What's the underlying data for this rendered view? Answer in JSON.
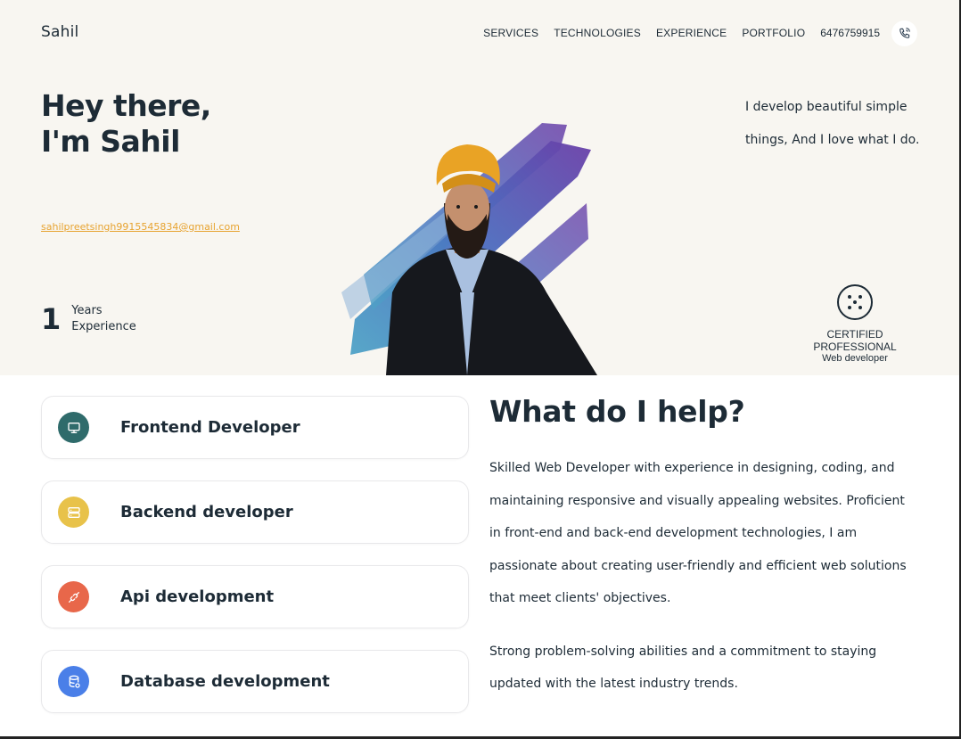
{
  "header": {
    "logo": "Sahil",
    "nav": [
      "SERVICES",
      "TECHNOLOGIES",
      "EXPERIENCE",
      "PORTFOLIO"
    ],
    "phone": "6476759915",
    "phone_icon": "phone-call-icon"
  },
  "hero": {
    "title_line1": "Hey there,",
    "title_line2": "I'm Sahil",
    "email": "sahilpreetsingh9915545834@gmail.com",
    "years_number": "1",
    "years_label_line1": "Years",
    "years_label_line2": "Experience",
    "tagline_line1": "I develop beautiful simple",
    "tagline_line2": "things, And I love what I do.",
    "cert_icon": "dice-icon",
    "cert_title": "CERTIFIED PROFESSIONAL",
    "cert_subtitle": "Web developer",
    "background_color": "#f8f6f1"
  },
  "services": [
    {
      "label": "Frontend Developer",
      "icon": "monitor-icon",
      "color": "#2f6b6b"
    },
    {
      "label": "Backend developer",
      "icon": "server-icon",
      "color": "#e8c24a"
    },
    {
      "label": "Api development",
      "icon": "plug-icon",
      "color": "#e8674a"
    },
    {
      "label": "Database development",
      "icon": "database-icon",
      "color": "#4a7fe8"
    }
  ],
  "help": {
    "title": "What do I help?",
    "para1_lines": [
      "Skilled Web Developer with experience in designing, coding, and",
      "maintaining responsive and visually appealing websites. Proficient",
      "in front-end and back-end development technologies, I am",
      "passionate about creating user-friendly and efficient web solutions",
      "that meet clients' objectives."
    ],
    "para2_lines": [
      "Strong problem-solving abilities and a commitment to staying",
      "updated with the latest industry trends."
    ]
  },
  "colors": {
    "text": "#1d2b36",
    "accent": "#e7a330"
  }
}
